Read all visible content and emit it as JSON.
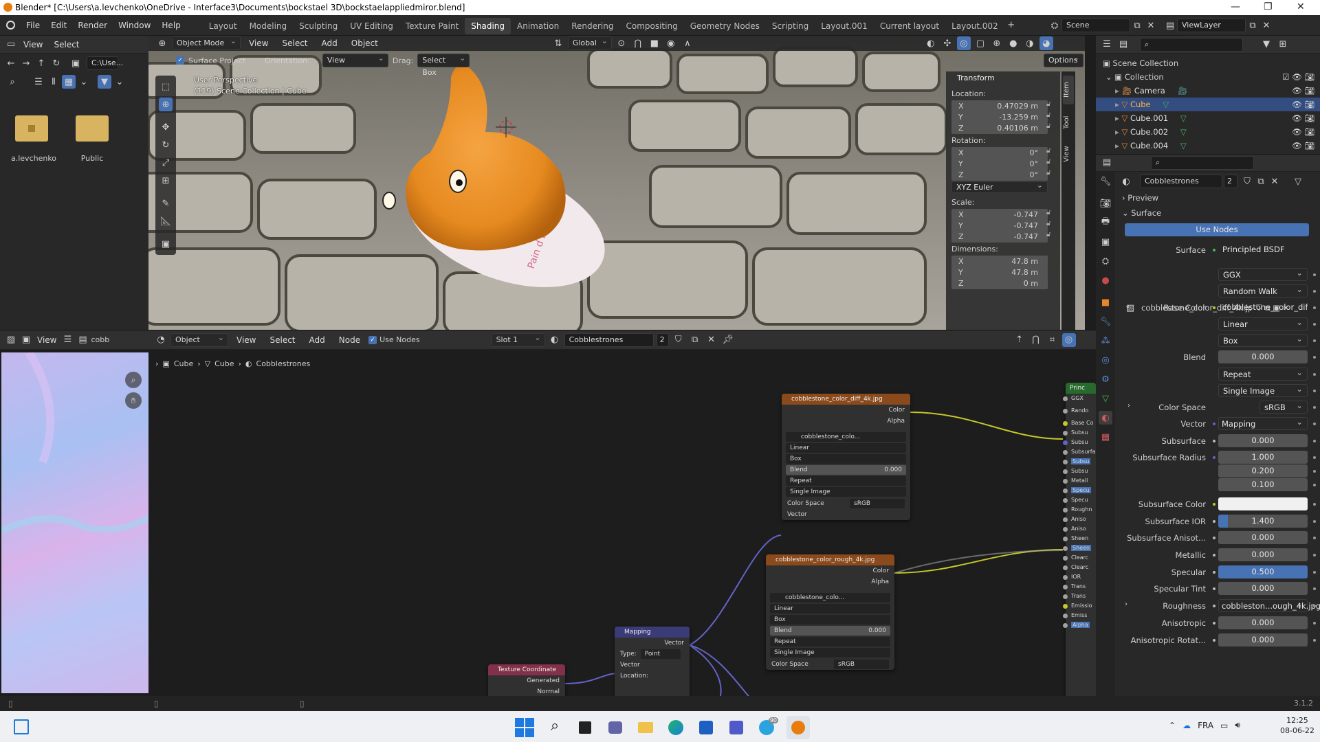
{
  "window": {
    "title": "Blender* [C:\\Users\\a.levchenko\\OneDrive - Interface3\\Documents\\bockstael 3D\\bockstaelappliedmiror.blend]",
    "min": "—",
    "max": "❐",
    "close": "✕"
  },
  "topmenu": [
    "File",
    "Edit",
    "Render",
    "Window",
    "Help"
  ],
  "workspaces": [
    "Layout",
    "Modeling",
    "Sculpting",
    "UV Editing",
    "Texture Paint",
    "Shading",
    "Animation",
    "Rendering",
    "Compositing",
    "Geometry Nodes",
    "Scripting",
    "Layout.001",
    "Current layout",
    "Layout.002"
  ],
  "active_workspace": "Shading",
  "scene": {
    "name": "Scene",
    "viewlayer": "ViewLayer"
  },
  "filebrowser": {
    "menu": [
      "View",
      "Select"
    ],
    "path": "C:\\Use...",
    "items": [
      {
        "label": "a.levchenko",
        "icon": "home-folder-icon"
      },
      {
        "label": "Public",
        "icon": "folder-icon"
      }
    ]
  },
  "viewport": {
    "header": {
      "mode": "Object Mode",
      "menus": [
        "View",
        "Select",
        "Add",
        "Object"
      ],
      "transform": "Global"
    },
    "tool_header": {
      "surface_project": "Surface Project",
      "orientation_label": "Orientation:",
      "orientation": "View",
      "drag_label": "Drag:",
      "drag": "Select Box",
      "options": "Options"
    },
    "overlay_text1": "User Perspective",
    "overlay_text2": "(119) Scene Collection | Cube",
    "side_tabs": [
      "Item",
      "Tool",
      "View"
    ],
    "transform_panel": {
      "title": "Transform",
      "location_label": "Location:",
      "location": [
        {
          "axis": "X",
          "value": "0.47029 m"
        },
        {
          "axis": "Y",
          "value": "-13.259 m"
        },
        {
          "axis": "Z",
          "value": "0.40106 m"
        }
      ],
      "rotation_label": "Rotation:",
      "rotation": [
        {
          "axis": "X",
          "value": "0°"
        },
        {
          "axis": "Y",
          "value": "0°"
        },
        {
          "axis": "Z",
          "value": "0°"
        }
      ],
      "rotation_mode": "XYZ Euler",
      "scale_label": "Scale:",
      "scale": [
        {
          "axis": "X",
          "value": "-0.747"
        },
        {
          "axis": "Y",
          "value": "-0.747"
        },
        {
          "axis": "Z",
          "value": "-0.747"
        }
      ],
      "dimensions_label": "Dimensions:",
      "dimensions": [
        {
          "axis": "X",
          "value": "47.8 m"
        },
        {
          "axis": "Y",
          "value": "47.8 m"
        },
        {
          "axis": "Z",
          "value": "0 m"
        }
      ]
    },
    "paper_text": "Pain d Done"
  },
  "image_editor": {
    "view": "View",
    "image": "cobb"
  },
  "node_editor": {
    "header": {
      "type": "Object",
      "menus": [
        "View",
        "Select",
        "Add",
        "Node"
      ],
      "use_nodes": "Use Nodes",
      "slot": "Slot 1",
      "material": "Cobblestrones",
      "users": "2"
    },
    "breadcrumb": [
      "Cube",
      "Cube",
      "Cobblestrones"
    ],
    "nodes": {
      "diff": {
        "title": "cobblestone_color_diff_4k.jpg",
        "out1": "Color",
        "out2": "Alpha",
        "image": "cobblestone_colo...",
        "interp": "Linear",
        "proj": "Box",
        "blend_label": "Blend",
        "blend": "0.000",
        "ext": "Repeat",
        "source": "Single Image",
        "cs_label": "Color Space",
        "cs": "sRGB",
        "in": "Vector"
      },
      "rough": {
        "title": "cobblestone_color_rough_4k.jpg",
        "out1": "Color",
        "out2": "Alpha",
        "image": "cobblestone_colo...",
        "interp": "Linear",
        "proj": "Box",
        "blend_label": "Blend",
        "blend": "0.000",
        "ext": "Repeat",
        "source": "Single Image",
        "cs_label": "Color Space",
        "cs": "sRGB"
      },
      "mapping": {
        "title": "Mapping",
        "out": "Vector",
        "type_label": "Type:",
        "type": "Point",
        "in": "Vector",
        "loc": "Location:"
      },
      "texcoord": {
        "title": "Texture Coordinate",
        "out1": "Generated",
        "out2": "Normal"
      },
      "principled": {
        "title": "Princ",
        "inputs": [
          "GGX",
          "Rando",
          "Base Co",
          "Subsu",
          "Subsu",
          "Subsurfa",
          "Subsu",
          "Subsu",
          "Metall",
          "Specu",
          "Specu",
          "Roughn",
          "Aniso",
          "Aniso",
          "Sheen",
          "Sheen",
          "Clearc",
          "Clearc",
          "IOR",
          "Trans",
          "Trans",
          "Emissio",
          "Emiss",
          "Alpha"
        ]
      }
    }
  },
  "outliner": {
    "root": "Scene Collection",
    "collection": "Collection",
    "items": [
      "Camera",
      "Cube",
      "Cube.001",
      "Cube.002",
      "Cube.004"
    ],
    "selected": "Cube"
  },
  "properties": {
    "material": "Cobblestrones",
    "users": "2",
    "preview": "Preview",
    "surface_panel": "Surface",
    "use_nodes": "Use Nodes",
    "rows": {
      "surface_label": "Surface",
      "surface": "Principled BSDF",
      "dist": "GGX",
      "sss_method": "Random Walk",
      "base_color_label": "Base Color",
      "base_color": "cobblestone_color_diff...",
      "image": "cobblestone_color_diff_4k.jpg",
      "interp": "Linear",
      "proj": "Box",
      "blend_label": "Blend",
      "blend": "0.000",
      "ext": "Repeat",
      "source": "Single Image",
      "cs_label": "Color Space",
      "cs": "sRGB",
      "vector_label": "Vector",
      "vector": "Mapping",
      "subsurface_label": "Subsurface",
      "subsurface": "0.000",
      "ssr_label": "Subsurface Radius",
      "ssr1": "1.000",
      "ssr2": "0.200",
      "ssr3": "0.100",
      "ssc_label": "Subsurface Color",
      "ssior_label": "Subsurface IOR",
      "ssior": "1.400",
      "ssan_label": "Subsurface Anisot...",
      "ssan": "0.000",
      "metal_label": "Metallic",
      "metal": "0.000",
      "spec_label": "Specular",
      "spec": "0.500",
      "spect_label": "Specular Tint",
      "spect": "0.000",
      "rough_label": "Roughness",
      "rough": "cobbleston...ough_4k.jpg",
      "aniso_label": "Anisotropic",
      "aniso": "0.000",
      "anisor_label": "Anisotropic Rotat...",
      "anisor": "0.000"
    }
  },
  "status": {
    "version": "3.1.2"
  },
  "taskbar": {
    "lang": "FRA",
    "time": "12:25",
    "date": "08-06-22",
    "badge": "90"
  },
  "colors": {
    "accent": "#4772b3",
    "selected_row": "#334d80",
    "node_image_header": "#8b4a1c",
    "node_vector_header": "#3b3b78",
    "node_input_header": "#83314a",
    "node_shader_header": "#286a2e"
  }
}
